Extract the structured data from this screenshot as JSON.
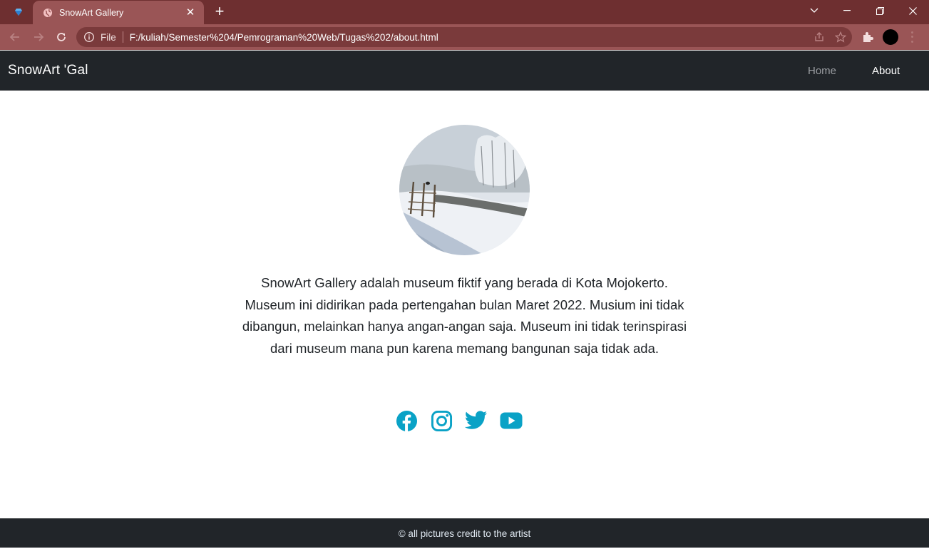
{
  "browser": {
    "tab_title": "SnowArt Gallery",
    "tab_close": "✕",
    "new_tab": "+",
    "scheme_label": "File",
    "url": "F:/kuliah/Semester%204/Pemrograman%20Web/Tugas%202/about.html"
  },
  "navbar": {
    "brand": "SnowArt 'Gal",
    "links": [
      {
        "label": "Home",
        "active": false
      },
      {
        "label": "About",
        "active": true
      }
    ]
  },
  "about": {
    "text": "SnowArt Gallery adalah museum fiktif yang berada di Kota Mojokerto. Museum ini didirikan pada pertengahan bulan Maret 2022. Musium ini tidak dibangun, melainkan hanya angan-angan saja. Museum ini tidak terinspirasi dari museum mana pun karena memang bangunan saja tidak ada."
  },
  "socials": [
    {
      "icon": "facebook-icon"
    },
    {
      "icon": "instagram-icon"
    },
    {
      "icon": "twitter-icon"
    },
    {
      "icon": "youtube-icon"
    }
  ],
  "footer": {
    "text": "© all pictures credit to the artist"
  },
  "colors": {
    "tabstrip": "#6e2f30",
    "toolbar": "#9a5556",
    "navbar": "#212529",
    "social_accent": "#0aa2c6"
  }
}
